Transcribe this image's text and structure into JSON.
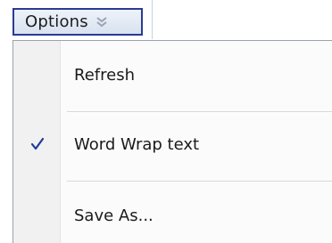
{
  "toolbar": {
    "options_label": "Options",
    "options_icon": "double-chevron-down-icon"
  },
  "menu": {
    "items": [
      {
        "label": "Refresh",
        "checked": false
      },
      {
        "label": "Word Wrap text",
        "checked": true,
        "check_icon": "checkmark-icon"
      },
      {
        "label": "Save As...",
        "checked": false
      }
    ]
  },
  "colors": {
    "button_border": "#2b3a93",
    "check_color": "#1e3a9a",
    "menu_gutter": "#f1f1f1"
  }
}
